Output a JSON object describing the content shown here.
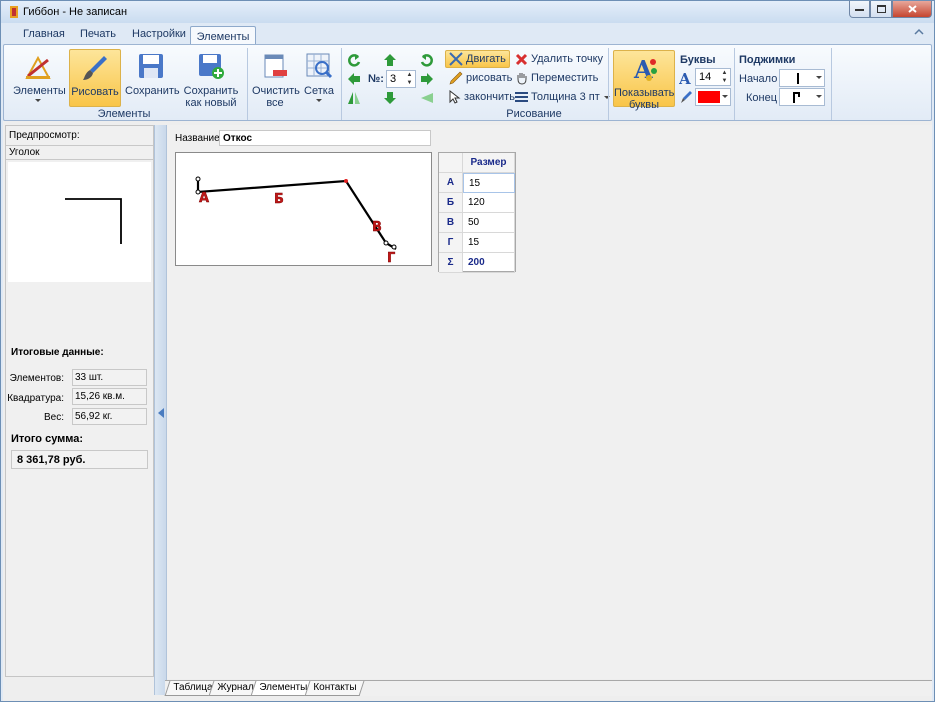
{
  "window": {
    "title": "Гиббон - Не записан"
  },
  "tabs": {
    "items": [
      "Главная",
      "Печать",
      "Настройки"
    ],
    "active": "Элементы"
  },
  "ribbon": {
    "elements_group": {
      "label": "Элементы",
      "btn_elements": "Элементы",
      "btn_draw": "Рисовать",
      "btn_save": "Сохранить",
      "btn_save_new_1": "Сохранить",
      "btn_save_new_2": "как новый"
    },
    "draw_group": {
      "label": "Рисование",
      "btn_clear_1": "Очистить",
      "btn_clear_2": "все",
      "btn_grid": "Сетка",
      "num_label": "№:",
      "num_value": "3",
      "btn_move": "Двигать",
      "btn_draw_small": "рисовать",
      "btn_finish": "закончить",
      "btn_delete_point": "Удалить точку",
      "btn_shift": "Переместить",
      "thickness": "Толщина 3 пт",
      "btn_show_letters_1": "Показывать",
      "btn_show_letters_2": "буквы"
    },
    "letters": {
      "title": "Буквы",
      "size": "14",
      "color": "#ff0000"
    },
    "clamps": {
      "title": "Поджимки",
      "start_label": "Начало",
      "end_label": "Конец"
    }
  },
  "left": {
    "preview_label": "Предпросмотр:",
    "preview_name": "Уголок",
    "totals_title": "Итоговые данные:",
    "elements_label": "Элементов:",
    "elements_value": "33 шт.",
    "area_label": "Квадратура:",
    "area_value": "15,26 кв.м.",
    "weight_label": "Вес:",
    "weight_value": "56,92 кг.",
    "sum_title": "Итого сумма:",
    "sum_value": "8 361,78 руб."
  },
  "main": {
    "name_label": "Название:",
    "name_value": "Откос",
    "drawing_letters": [
      "А",
      "Б",
      "В",
      "Г"
    ],
    "grid": {
      "header": "Размер",
      "rows": [
        {
          "key": "А",
          "val": "15"
        },
        {
          "key": "Б",
          "val": "120"
        },
        {
          "key": "В",
          "val": "50"
        },
        {
          "key": "Г",
          "val": "15"
        },
        {
          "key": "Σ",
          "val": "200"
        }
      ]
    }
  },
  "bottom_tabs": [
    "Таблица",
    "Журнал",
    "Элементы",
    "Контакты"
  ]
}
